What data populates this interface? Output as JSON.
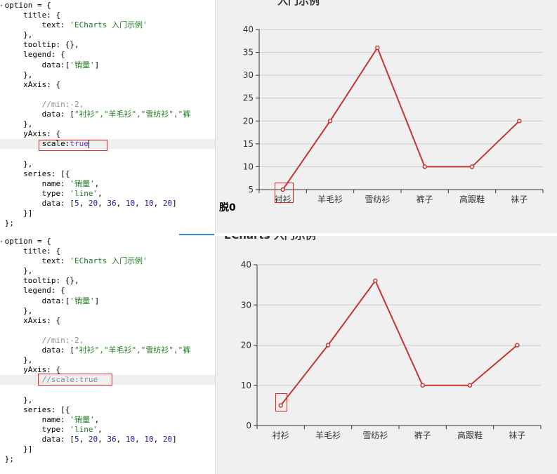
{
  "top": {
    "code_lines": [
      {
        "fold": true,
        "indent": 0,
        "tokens": [
          {
            "t": "option = {"
          }
        ]
      },
      {
        "indent": 4,
        "tokens": [
          {
            "t": "title: {"
          }
        ]
      },
      {
        "indent": 8,
        "tokens": [
          {
            "t": "text: "
          },
          {
            "t": "'ECharts 入门示例'",
            "c": "str"
          }
        ]
      },
      {
        "indent": 4,
        "tokens": [
          {
            "t": "},"
          }
        ]
      },
      {
        "indent": 4,
        "tokens": [
          {
            "t": "tooltip: {},"
          }
        ]
      },
      {
        "indent": 4,
        "tokens": [
          {
            "t": "legend: {"
          }
        ]
      },
      {
        "indent": 8,
        "tokens": [
          {
            "t": "data:["
          },
          {
            "t": "'销量'",
            "c": "str"
          },
          {
            "t": "]"
          }
        ]
      },
      {
        "indent": 4,
        "tokens": [
          {
            "t": "},"
          }
        ]
      },
      {
        "indent": 4,
        "tokens": [
          {
            "t": "xAxis: {"
          }
        ]
      },
      {
        "indent": 0,
        "tokens": []
      },
      {
        "indent": 8,
        "tokens": [
          {
            "t": "//min:-2,",
            "c": "com"
          }
        ]
      },
      {
        "indent": 8,
        "tokens": [
          {
            "t": "data: ["
          },
          {
            "t": "\"衬衫\",\"羊毛衫\",\"雪纺衫\",\"裤",
            "c": "str"
          }
        ]
      },
      {
        "indent": 4,
        "tokens": [
          {
            "t": "},"
          }
        ]
      },
      {
        "indent": 4,
        "tokens": [
          {
            "t": "yAxis: {"
          }
        ]
      },
      {
        "indent": 8,
        "hl": true,
        "caret": true,
        "tokens": [
          {
            "t": "scale:"
          },
          {
            "t": "true",
            "c": "key"
          }
        ]
      },
      {
        "indent": 0,
        "tokens": []
      },
      {
        "indent": 4,
        "tokens": [
          {
            "t": "},"
          }
        ]
      },
      {
        "indent": 4,
        "tokens": [
          {
            "t": "series: [{"
          }
        ]
      },
      {
        "indent": 8,
        "tokens": [
          {
            "t": "name: "
          },
          {
            "t": "'销量'",
            "c": "str"
          },
          {
            "t": ","
          }
        ]
      },
      {
        "indent": 8,
        "tokens": [
          {
            "t": "type: "
          },
          {
            "t": "'line'",
            "c": "str"
          },
          {
            "t": ","
          }
        ]
      },
      {
        "indent": 8,
        "tokens": [
          {
            "t": "data: ["
          },
          {
            "t": "5",
            "c": "num"
          },
          {
            "t": ", "
          },
          {
            "t": "20",
            "c": "num"
          },
          {
            "t": ", "
          },
          {
            "t": "36",
            "c": "num"
          },
          {
            "t": ", "
          },
          {
            "t": "10",
            "c": "num"
          },
          {
            "t": ", "
          },
          {
            "t": "10",
            "c": "num"
          },
          {
            "t": ", "
          },
          {
            "t": "20",
            "c": "num"
          },
          {
            "t": "]"
          }
        ]
      },
      {
        "indent": 4,
        "tokens": [
          {
            "t": "}]"
          }
        ]
      },
      {
        "indent": 0,
        "tokens": [
          {
            "t": "};"
          }
        ]
      }
    ],
    "overlay_label": "脱0",
    "cutoff_title": "入门示例"
  },
  "bottom": {
    "code_lines": [
      {
        "fold": true,
        "indent": 0,
        "tokens": [
          {
            "t": "option = {"
          }
        ]
      },
      {
        "indent": 4,
        "tokens": [
          {
            "t": "title: {"
          }
        ]
      },
      {
        "indent": 8,
        "tokens": [
          {
            "t": "text: "
          },
          {
            "t": "'ECharts 入门示例'",
            "c": "str"
          }
        ]
      },
      {
        "indent": 4,
        "tokens": [
          {
            "t": "},"
          }
        ]
      },
      {
        "indent": 4,
        "tokens": [
          {
            "t": "tooltip: {},"
          }
        ]
      },
      {
        "indent": 4,
        "tokens": [
          {
            "t": "legend: {"
          }
        ]
      },
      {
        "indent": 8,
        "tokens": [
          {
            "t": "data:["
          },
          {
            "t": "'销量'",
            "c": "str"
          },
          {
            "t": "]"
          }
        ]
      },
      {
        "indent": 4,
        "tokens": [
          {
            "t": "},"
          }
        ]
      },
      {
        "indent": 4,
        "tokens": [
          {
            "t": "xAxis: {"
          }
        ]
      },
      {
        "indent": 0,
        "tokens": []
      },
      {
        "indent": 8,
        "tokens": [
          {
            "t": "//min:-2,",
            "c": "com"
          }
        ]
      },
      {
        "indent": 8,
        "tokens": [
          {
            "t": "data: ["
          },
          {
            "t": "\"衬衫\",\"羊毛衫\",\"雪纺衫\",\"裤",
            "c": "str"
          }
        ]
      },
      {
        "indent": 4,
        "tokens": [
          {
            "t": "},"
          }
        ]
      },
      {
        "indent": 4,
        "tokens": [
          {
            "t": "yAxis: {"
          }
        ]
      },
      {
        "indent": 8,
        "hl": true,
        "tokens": [
          {
            "t": "//scale:true",
            "c": "com"
          }
        ]
      },
      {
        "indent": 0,
        "tokens": []
      },
      {
        "indent": 4,
        "tokens": [
          {
            "t": "},"
          }
        ]
      },
      {
        "indent": 4,
        "tokens": [
          {
            "t": "series: [{"
          }
        ]
      },
      {
        "indent": 8,
        "tokens": [
          {
            "t": "name: "
          },
          {
            "t": "'销量'",
            "c": "str"
          },
          {
            "t": ","
          }
        ]
      },
      {
        "indent": 8,
        "tokens": [
          {
            "t": "type: "
          },
          {
            "t": "'line'",
            "c": "str"
          },
          {
            "t": ","
          }
        ]
      },
      {
        "indent": 8,
        "tokens": [
          {
            "t": "data: ["
          },
          {
            "t": "5",
            "c": "num"
          },
          {
            "t": ", "
          },
          {
            "t": "20",
            "c": "num"
          },
          {
            "t": ", "
          },
          {
            "t": "36",
            "c": "num"
          },
          {
            "t": ", "
          },
          {
            "t": "10",
            "c": "num"
          },
          {
            "t": ", "
          },
          {
            "t": "10",
            "c": "num"
          },
          {
            "t": ", "
          },
          {
            "t": "20",
            "c": "num"
          },
          {
            "t": "]"
          }
        ]
      },
      {
        "indent": 4,
        "tokens": [
          {
            "t": "}]"
          }
        ]
      },
      {
        "indent": 0,
        "tokens": [
          {
            "t": "};"
          }
        ]
      }
    ],
    "cutoff_title": "ECharts 入门示例"
  },
  "chart_data": [
    {
      "type": "line",
      "categories": [
        "衬衫",
        "羊毛衫",
        "雪纺衫",
        "裤子",
        "高跟鞋",
        "袜子"
      ],
      "series": [
        {
          "values": [
            5,
            20,
            36,
            10,
            10,
            20
          ]
        }
      ],
      "ylim": [
        5,
        40
      ],
      "yticks": [
        "5",
        "10",
        "15",
        "20",
        "25",
        "30",
        "35",
        "40"
      ],
      "grid": true,
      "color": "#c23531"
    },
    {
      "type": "line",
      "categories": [
        "衬衫",
        "羊毛衫",
        "雪纺衫",
        "裤子",
        "高跟鞋",
        "袜子"
      ],
      "series": [
        {
          "values": [
            5,
            20,
            36,
            10,
            10,
            20
          ]
        }
      ],
      "ylim": [
        0,
        40
      ],
      "yticks": [
        "0",
        "10",
        "20",
        "30",
        "40"
      ],
      "grid": true,
      "color": "#c23531"
    }
  ]
}
